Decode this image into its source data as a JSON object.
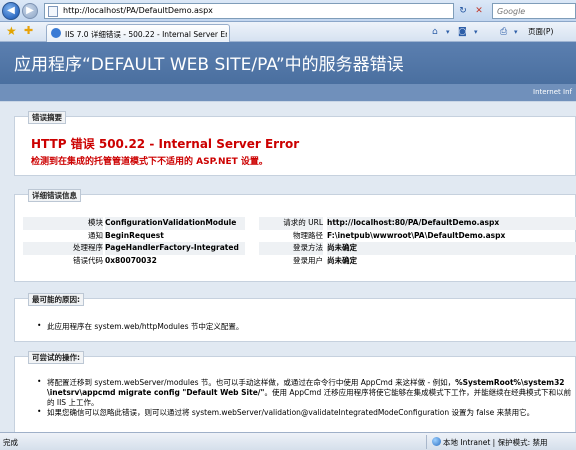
{
  "browser": {
    "url": "http://localhost/PA/DefaultDemo.aspx",
    "search_placeholder": "Google",
    "tab_title": "IIS 7.0 详细错误 - 500.22 - Internal Server Err...",
    "page_menu": "页面(P)",
    "status_done": "完成",
    "status_zone": "本地 Intranet | 保护模式: 禁用"
  },
  "page": {
    "header_title": "应用程序“DEFAULT WEB SITE/PA”中的服务器错误",
    "header_right": "Internet Inf",
    "summary": {
      "legend": "错误摘要",
      "title": "HTTP 错误 500.22 - Internal Server Error",
      "subtitle": "检测到在集成的托管管道模式下不适用的 ASP.NET 设置。"
    },
    "details": {
      "legend": "详细错误信息",
      "left": [
        {
          "key": "模块",
          "value": "ConfigurationValidationModule"
        },
        {
          "key": "通知",
          "value": "BeginRequest"
        },
        {
          "key": "处理程序",
          "value": "PageHandlerFactory-Integrated"
        },
        {
          "key": "错误代码",
          "value": "0x80070032"
        }
      ],
      "right": [
        {
          "key": "请求的 URL",
          "value": "http://localhost:80/PA/DefaultDemo.aspx"
        },
        {
          "key": "物理路径",
          "value": "F:\\inetpub\\wwwroot\\PA\\DefaultDemo.aspx"
        },
        {
          "key": "登录方法",
          "value": "尚未确定"
        },
        {
          "key": "登录用户",
          "value": "尚未确定"
        }
      ]
    },
    "causes": {
      "legend": "最可能的原因:",
      "items": [
        "此应用程序在 system.web/httpModules 节中定义配置。"
      ]
    },
    "actions": {
      "legend": "可尝试的操作:",
      "line1a": "将配置迁移到 system.webServer/modules 节。也可以手动这样做，或通过在命令行中使用 AppCmd 来这样做 - 例如，",
      "line1b": "%SystemRoot%\\system32",
      "line2a": "\\inetsrv\\appcmd migrate config \"Default Web Site/\"",
      "line2b": "。使用 AppCmd 迁移应用程序将使它能够在集成模式下工作，并能继续在经典模式下和以前",
      "line3": "的 IIS 上工作。",
      "line4": "如果您确信可以忽略此错误，则可以通过将 system.webServer/validation@validateIntegratedModeConfiguration 设置为 false 来禁用它。"
    }
  }
}
